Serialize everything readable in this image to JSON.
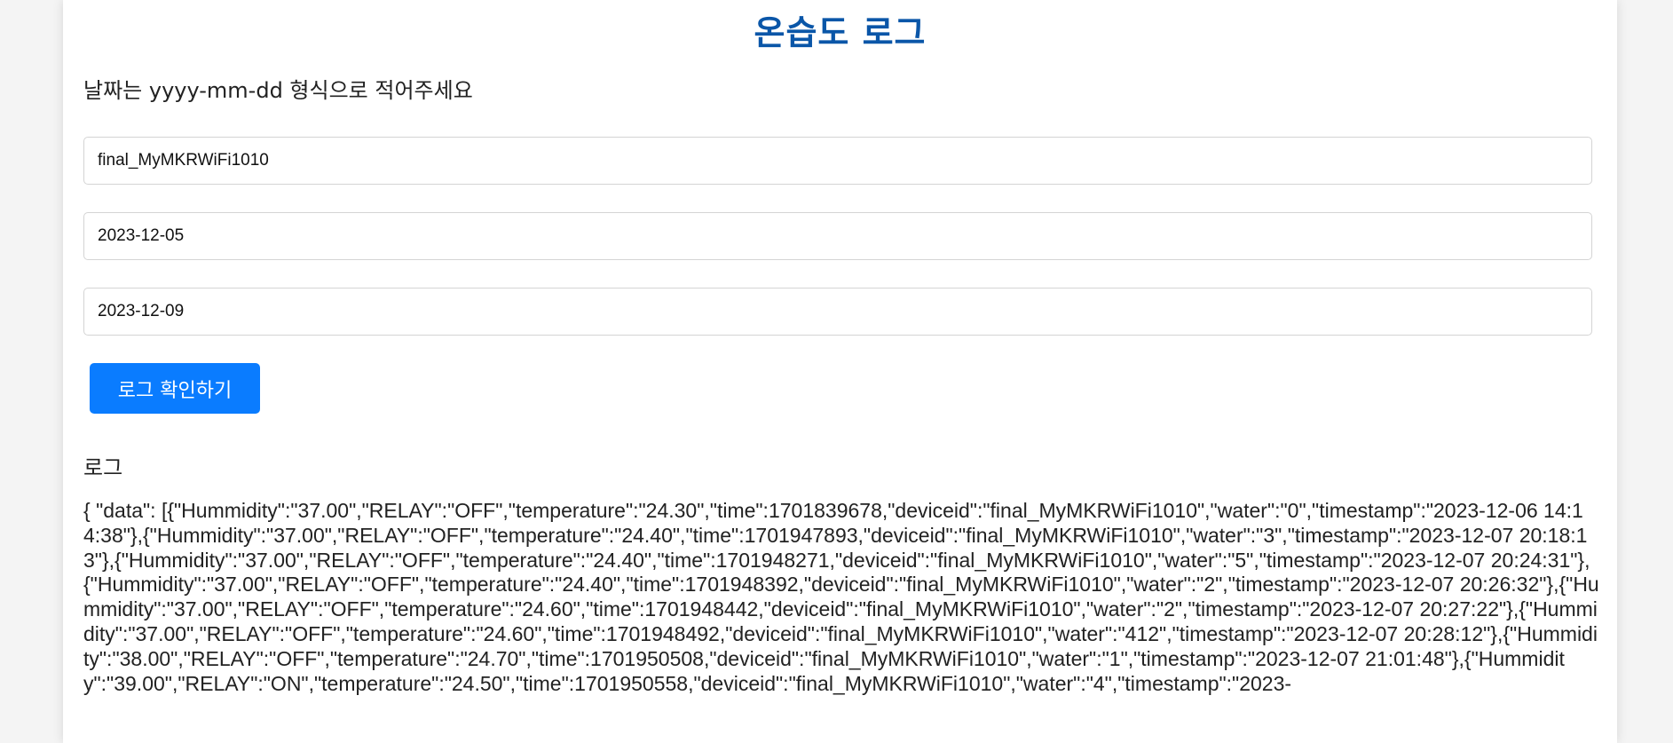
{
  "page": {
    "title": "온습도 로그",
    "instruction": "날짜는 yyyy-mm-dd 형식으로 적어주세요"
  },
  "form": {
    "device_id_value": "final_MyMKRWiFi1010",
    "start_date_value": "2023-12-05",
    "end_date_value": "2023-12-09",
    "submit_label": "로그 확인하기"
  },
  "log": {
    "heading": "로그",
    "content": "{ \"data\": [{\"Hummidity\":\"37.00\",\"RELAY\":\"OFF\",\"temperature\":\"24.30\",\"time\":1701839678,\"deviceid\":\"final_MyMKRWiFi1010\",\"water\":\"0\",\"timestamp\":\"2023-12-06 14:14:38\"},{\"Hummidity\":\"37.00\",\"RELAY\":\"OFF\",\"temperature\":\"24.40\",\"time\":1701947893,\"deviceid\":\"final_MyMKRWiFi1010\",\"water\":\"3\",\"timestamp\":\"2023-12-07 20:18:13\"},{\"Hummidity\":\"37.00\",\"RELAY\":\"OFF\",\"temperature\":\"24.40\",\"time\":1701948271,\"deviceid\":\"final_MyMKRWiFi1010\",\"water\":\"5\",\"timestamp\":\"2023-12-07 20:24:31\"},{\"Hummidity\":\"37.00\",\"RELAY\":\"OFF\",\"temperature\":\"24.40\",\"time\":1701948392,\"deviceid\":\"final_MyMKRWiFi1010\",\"water\":\"2\",\"timestamp\":\"2023-12-07 20:26:32\"},{\"Hummidity\":\"37.00\",\"RELAY\":\"OFF\",\"temperature\":\"24.60\",\"time\":1701948442,\"deviceid\":\"final_MyMKRWiFi1010\",\"water\":\"2\",\"timestamp\":\"2023-12-07 20:27:22\"},{\"Hummidity\":\"37.00\",\"RELAY\":\"OFF\",\"temperature\":\"24.60\",\"time\":1701948492,\"deviceid\":\"final_MyMKRWiFi1010\",\"water\":\"412\",\"timestamp\":\"2023-12-07 20:28:12\"},{\"Hummidity\":\"38.00\",\"RELAY\":\"OFF\",\"temperature\":\"24.70\",\"time\":1701950508,\"deviceid\":\"final_MyMKRWiFi1010\",\"water\":\"1\",\"timestamp\":\"2023-12-07 21:01:48\"},{\"Hummidity\":\"39.00\",\"RELAY\":\"ON\",\"temperature\":\"24.50\",\"time\":1701950558,\"deviceid\":\"final_MyMKRWiFi1010\",\"water\":\"4\",\"timestamp\":\"2023-"
  },
  "colors": {
    "title": "#0a56a8",
    "button_bg": "#0a7cff",
    "button_text": "#ffffff",
    "page_bg": "#f4f4f4",
    "card_bg": "#ffffff"
  }
}
